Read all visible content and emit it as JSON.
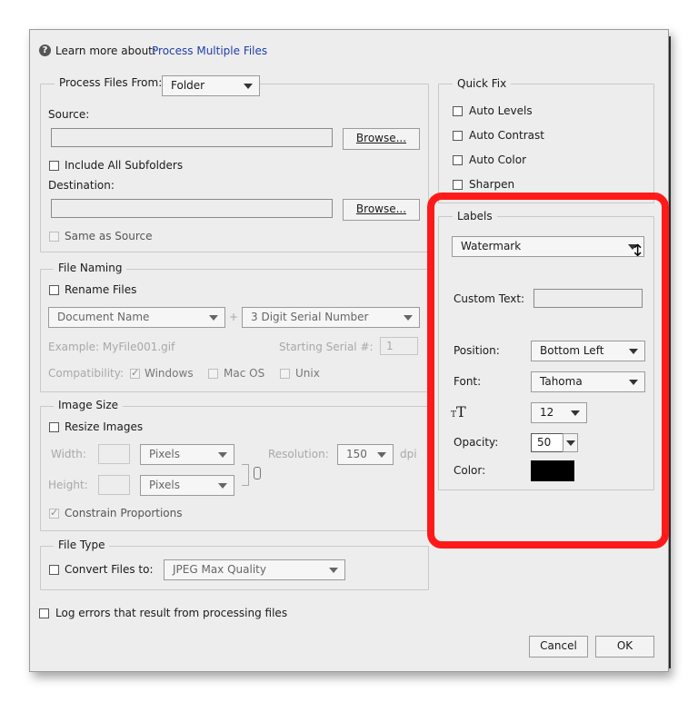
{
  "header": {
    "learn_more_prefix": "Learn more about:",
    "learn_more_link": "Process Multiple Files"
  },
  "process_files": {
    "legend": "Process Files From:",
    "from_value": "Folder",
    "source_label": "Source:",
    "browse_label": "Browse...",
    "include_subfolders": "Include All Subfolders",
    "destination_label": "Destination:",
    "same_as_source": "Same as Source"
  },
  "file_naming": {
    "legend": "File Naming",
    "rename_files": "Rename Files",
    "name_option": "Document Name",
    "plus": "+",
    "serial_option": "3 Digit Serial Number",
    "example": "Example: MyFile001.gif",
    "starting_serial_label": "Starting Serial #:",
    "starting_serial_value": "1",
    "compatibility_label": "Compatibility:",
    "windows": "Windows",
    "mac_os": "Mac OS",
    "unix": "Unix"
  },
  "image_size": {
    "legend": "Image Size",
    "resize_images": "Resize Images",
    "width_label": "Width:",
    "height_label": "Height:",
    "width_unit": "Pixels",
    "height_unit": "Pixels",
    "resolution_label": "Resolution:",
    "resolution_value": "150",
    "dpi": "dpi",
    "constrain": "Constrain Proportions"
  },
  "file_type": {
    "legend": "File Type",
    "convert_label": "Convert Files to:",
    "convert_value": "JPEG Max Quality"
  },
  "log_errors": "Log errors that result from processing files",
  "quick_fix": {
    "legend": "Quick Fix",
    "items": [
      "Auto Levels",
      "Auto Contrast",
      "Auto Color",
      "Sharpen"
    ]
  },
  "labels": {
    "legend": "Labels",
    "type_value": "Watermark",
    "custom_text_label": "Custom Text:",
    "position_label": "Position:",
    "position_value": "Bottom Left",
    "font_label": "Font:",
    "font_value": "Tahoma",
    "size_value": "12",
    "opacity_label": "Opacity:",
    "opacity_value": "50",
    "color_label": "Color:",
    "color_swatch": "#000000"
  },
  "footer": {
    "cancel_label": "Cancel",
    "ok_label": "OK"
  },
  "colors": {
    "highlight": "#ff1a1a",
    "link": "#1f3fa8"
  }
}
